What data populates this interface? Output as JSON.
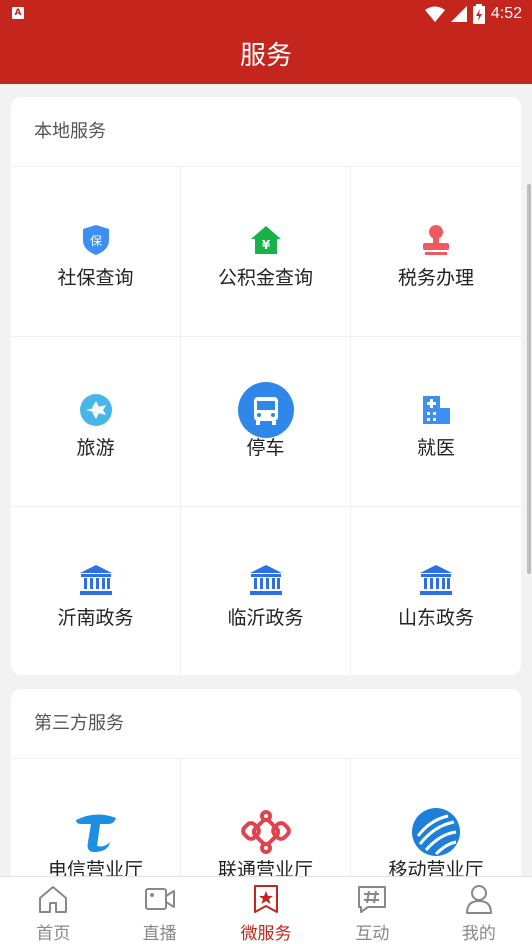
{
  "status_bar": {
    "notification_icon": "A",
    "time": "4:52"
  },
  "header": {
    "title": "服务"
  },
  "local_services": {
    "heading": "本地服务",
    "items": [
      {
        "label": "社保查询",
        "icon": "shield-icon",
        "icon_text": "保",
        "color": "#3d8ff2"
      },
      {
        "label": "公积金查询",
        "icon": "house-icon",
        "icon_text": "¥",
        "color": "#17b34a"
      },
      {
        "label": "税务办理",
        "icon": "stamp-icon",
        "color": "#ef5a5f"
      },
      {
        "label": "旅游",
        "icon": "plane-icon",
        "color": "#48b6e8"
      },
      {
        "label": "停车",
        "icon": "bus-icon",
        "color": "#2f87e9"
      },
      {
        "label": "就医",
        "icon": "hospital-icon",
        "color": "#3d8ff2"
      },
      {
        "label": "沂南政务",
        "icon": "government-icon",
        "color": "#2f6fe6"
      },
      {
        "label": "临沂政务",
        "icon": "government-icon",
        "color": "#2f6fe6"
      },
      {
        "label": "山东政务",
        "icon": "government-icon",
        "color": "#2f6fe6"
      }
    ]
  },
  "third_party_services": {
    "heading": "第三方服务",
    "items": [
      {
        "label": "电信营业厅",
        "icon": "china-telecom-icon",
        "color": "#1a8fe3"
      },
      {
        "label": "联通营业厅",
        "icon": "china-unicom-icon",
        "color": "#e0434d"
      },
      {
        "label": "移动营业厅",
        "icon": "china-mobile-icon",
        "color": "#1d7fd8"
      }
    ]
  },
  "tab_bar": {
    "active": "微服务",
    "items": [
      {
        "label": "首页",
        "icon": "home-icon"
      },
      {
        "label": "直播",
        "icon": "video-icon"
      },
      {
        "label": "微服务",
        "icon": "star-bookmark-icon"
      },
      {
        "label": "互动",
        "icon": "hashtag-chat-icon"
      },
      {
        "label": "我的",
        "icon": "user-icon"
      }
    ]
  },
  "colors": {
    "brand": "#c4251d",
    "background": "#f2f2f2",
    "inactive_tab": "#888888"
  }
}
